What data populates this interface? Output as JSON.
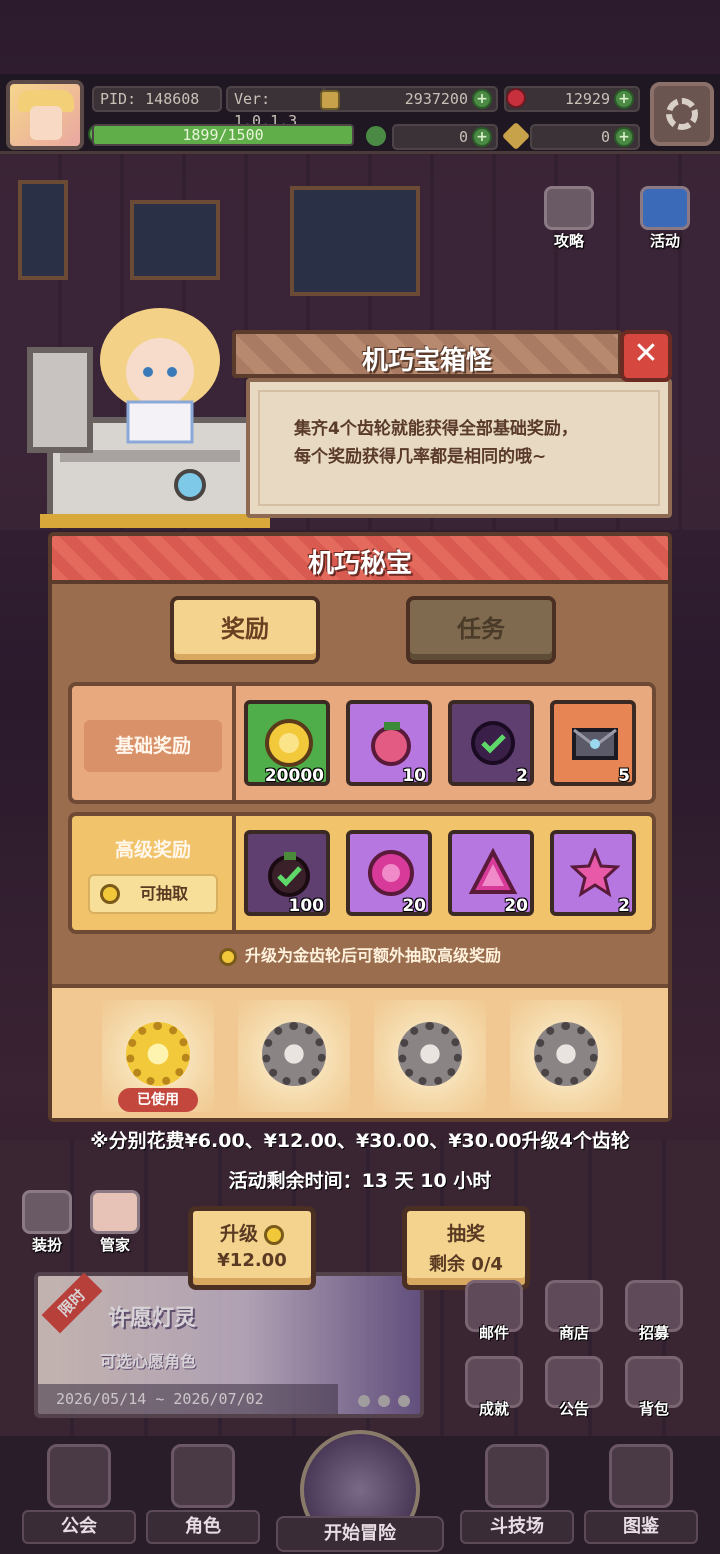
{
  "topbar": {
    "pid": "PID: 148608",
    "version": "Ver: 1.0.1.3",
    "coins": "2937200",
    "gems": "12929",
    "xp": "1899/1500",
    "xp_fraction": 1.0,
    "clover": "0",
    "key": "0"
  },
  "side": {
    "guide_label": "攻略",
    "event_label": "活动",
    "dress_label": "装扮",
    "butler_label": "管家"
  },
  "dialog": {
    "title": "机巧宝箱怪",
    "close": "✕",
    "line1": "集齐4个齿轮就能获得全部基础奖励，",
    "line2": "每个奖励获得几率都是相同的哦~"
  },
  "panel": {
    "title": "机巧秘宝",
    "tab_rewards": "奖励",
    "tab_tasks": "任务",
    "basic_label": "基础奖励",
    "advanced_label": "高级奖励",
    "draw_label": "可抽取",
    "basic_items": [
      {
        "icon": "gold-coin-icon",
        "qty": "20000",
        "bg": "#4fae4a"
      },
      {
        "icon": "pink-fruit-icon",
        "qty": "10",
        "bg": "#b777e0"
      },
      {
        "icon": "purple-check-orb-icon",
        "qty": "2",
        "bg": "#5f3f70"
      },
      {
        "icon": "heart-letter-icon",
        "qty": "5",
        "bg": "#e78554"
      }
    ],
    "advanced_items": [
      {
        "icon": "dark-check-fruit-icon",
        "qty": "100",
        "bg": "#5f3f70"
      },
      {
        "icon": "pink-gem-icon",
        "qty": "20",
        "bg": "#b777e0"
      },
      {
        "icon": "pink-triangle-gem-icon",
        "qty": "20",
        "bg": "#b777e0"
      },
      {
        "icon": "pink-star-icon",
        "qty": "2",
        "bg": "#b777e0"
      }
    ],
    "note": "升级为金齿轮后可额外抽取高级奖励",
    "gears": [
      {
        "type": "gold",
        "tag": "已使用"
      },
      {
        "type": "grey",
        "tag": ""
      },
      {
        "type": "grey",
        "tag": ""
      },
      {
        "type": "grey",
        "tag": ""
      }
    ]
  },
  "info": {
    "price_line": "※分别花费¥6.00、¥12.00、¥30.00、¥30.00升级4个齿轮",
    "time_line": "活动剩余时间：13 天 10 小时"
  },
  "actions": {
    "upgrade_label": "升级",
    "upgrade_price": "¥12.00",
    "draw_label": "抽奖",
    "draw_remaining": "剩余 0/4"
  },
  "banner": {
    "limited": "限时",
    "title": "许愿灯灵",
    "subtitle": "可选心愿角色",
    "dates": "2026/05/14 ~ 2026/07/02"
  },
  "grid": {
    "mail": "邮件",
    "shop": "商店",
    "recruit": "招募",
    "achieve": "成就",
    "notice": "公告",
    "bag": "背包"
  },
  "nav": {
    "guild": "公会",
    "character": "角色",
    "adventure": "开始冒险",
    "arena": "斗技场",
    "codex": "图鉴"
  },
  "colors": {
    "panel_title": "#e46a5e",
    "tab_active": "#f3d38d",
    "basic_row": "#e8a97f",
    "advanced_row": "#f1c36b",
    "used_tag": "#c4473e"
  }
}
